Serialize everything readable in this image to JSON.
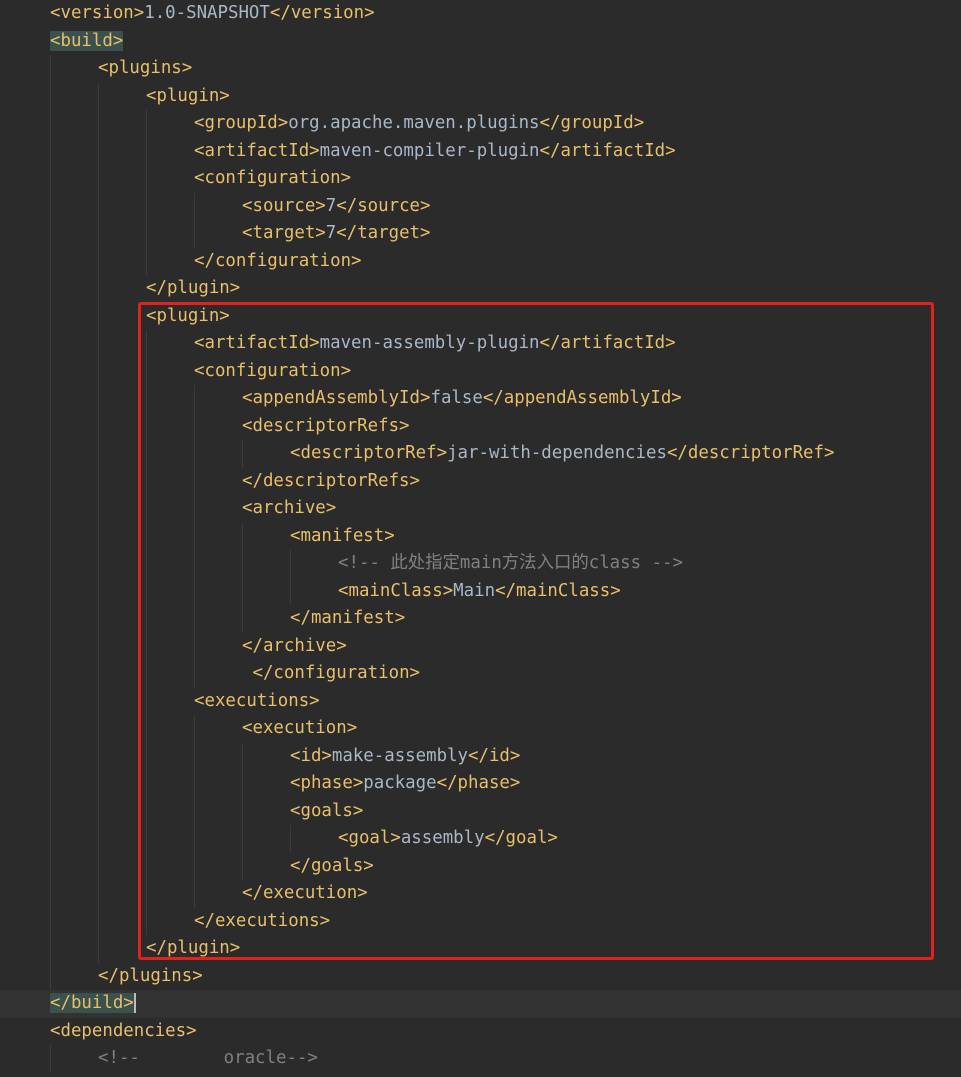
{
  "editor": {
    "language": "xml",
    "colors": {
      "background": "#2b2b2b",
      "tag": "#e8bf6a",
      "text": "#a9b7c6",
      "comment": "#808080",
      "matched_tag_background": "#3b514d",
      "annotation_box": "#e0231c"
    },
    "lines": [
      {
        "indent": 1,
        "parts": [
          {
            "t": "tag",
            "v": "<version>"
          },
          {
            "t": "txt",
            "v": "1.0-SNAPSHOT"
          },
          {
            "t": "tag",
            "v": "</version>"
          }
        ]
      },
      {
        "indent": 1,
        "parts": [
          {
            "t": "hl",
            "v": "<build>"
          }
        ]
      },
      {
        "indent": 2,
        "parts": [
          {
            "t": "tag",
            "v": "<plugins>"
          }
        ]
      },
      {
        "indent": 3,
        "parts": [
          {
            "t": "tag",
            "v": "<plugin>"
          }
        ]
      },
      {
        "indent": 4,
        "parts": [
          {
            "t": "tag",
            "v": "<groupId>"
          },
          {
            "t": "txt",
            "v": "org.apache.maven.plugins"
          },
          {
            "t": "tag",
            "v": "</groupId>"
          }
        ]
      },
      {
        "indent": 4,
        "parts": [
          {
            "t": "tag",
            "v": "<artifactId>"
          },
          {
            "t": "txt",
            "v": "maven-compiler-plugin"
          },
          {
            "t": "tag",
            "v": "</artifactId>"
          }
        ]
      },
      {
        "indent": 4,
        "parts": [
          {
            "t": "tag",
            "v": "<configuration>"
          }
        ]
      },
      {
        "indent": 5,
        "parts": [
          {
            "t": "tag",
            "v": "<source>"
          },
          {
            "t": "txt",
            "v": "7"
          },
          {
            "t": "tag",
            "v": "</source>"
          }
        ]
      },
      {
        "indent": 5,
        "parts": [
          {
            "t": "tag",
            "v": "<target>"
          },
          {
            "t": "txt",
            "v": "7"
          },
          {
            "t": "tag",
            "v": "</target>"
          }
        ]
      },
      {
        "indent": 4,
        "parts": [
          {
            "t": "tag",
            "v": "</configuration>"
          }
        ]
      },
      {
        "indent": 3,
        "parts": [
          {
            "t": "tag",
            "v": "</plugin>"
          }
        ]
      },
      {
        "indent": 3,
        "parts": [
          {
            "t": "tag",
            "v": "<plugin>"
          }
        ]
      },
      {
        "indent": 4,
        "parts": [
          {
            "t": "tag",
            "v": "<artifactId>"
          },
          {
            "t": "txt",
            "v": "maven-assembly-plugin"
          },
          {
            "t": "tag",
            "v": "</artifactId>"
          }
        ]
      },
      {
        "indent": 4,
        "parts": [
          {
            "t": "tag",
            "v": "<configuration>"
          }
        ]
      },
      {
        "indent": 5,
        "parts": [
          {
            "t": "tag",
            "v": "<appendAssemblyId>"
          },
          {
            "t": "txt",
            "v": "false"
          },
          {
            "t": "tag",
            "v": "</appendAssemblyId>"
          }
        ]
      },
      {
        "indent": 5,
        "parts": [
          {
            "t": "tag",
            "v": "<descriptorRefs>"
          }
        ]
      },
      {
        "indent": 6,
        "parts": [
          {
            "t": "tag",
            "v": "<descriptorRef>"
          },
          {
            "t": "txt",
            "v": "jar-with-dependencies"
          },
          {
            "t": "tag",
            "v": "</descriptorRef>"
          }
        ]
      },
      {
        "indent": 5,
        "parts": [
          {
            "t": "tag",
            "v": "</descriptorRefs>"
          }
        ]
      },
      {
        "indent": 5,
        "parts": [
          {
            "t": "tag",
            "v": "<archive>"
          }
        ]
      },
      {
        "indent": 6,
        "parts": [
          {
            "t": "tag",
            "v": "<manifest>"
          }
        ]
      },
      {
        "indent": 7,
        "parts": [
          {
            "t": "cmt",
            "v": "<!-- 此处指定main方法入口的class -->"
          }
        ]
      },
      {
        "indent": 7,
        "parts": [
          {
            "t": "tag",
            "v": "<mainClass>"
          },
          {
            "t": "txt",
            "v": "Main"
          },
          {
            "t": "tag",
            "v": "</mainClass>"
          }
        ]
      },
      {
        "indent": 6,
        "parts": [
          {
            "t": "tag",
            "v": "</manifest>"
          }
        ]
      },
      {
        "indent": 5,
        "parts": [
          {
            "t": "tag",
            "v": "</archive>"
          }
        ]
      },
      {
        "indent": 5,
        "parts": [
          {
            "t": "txt",
            "v": " "
          },
          {
            "t": "tag",
            "v": "</configuration>"
          }
        ]
      },
      {
        "indent": 4,
        "parts": [
          {
            "t": "tag",
            "v": "<executions>"
          }
        ]
      },
      {
        "indent": 5,
        "parts": [
          {
            "t": "tag",
            "v": "<execution>"
          }
        ]
      },
      {
        "indent": 6,
        "parts": [
          {
            "t": "tag",
            "v": "<id>"
          },
          {
            "t": "txt",
            "v": "make-assembly"
          },
          {
            "t": "tag",
            "v": "</id>"
          }
        ]
      },
      {
        "indent": 6,
        "parts": [
          {
            "t": "tag",
            "v": "<phase>"
          },
          {
            "t": "txt",
            "v": "package"
          },
          {
            "t": "tag",
            "v": "</phase>"
          }
        ]
      },
      {
        "indent": 6,
        "parts": [
          {
            "t": "tag",
            "v": "<goals>"
          }
        ]
      },
      {
        "indent": 7,
        "parts": [
          {
            "t": "tag",
            "v": "<goal>"
          },
          {
            "t": "txt",
            "v": "assembly"
          },
          {
            "t": "tag",
            "v": "</goal>"
          }
        ]
      },
      {
        "indent": 6,
        "parts": [
          {
            "t": "tag",
            "v": "</goals>"
          }
        ]
      },
      {
        "indent": 5,
        "parts": [
          {
            "t": "tag",
            "v": "</execution>"
          }
        ]
      },
      {
        "indent": 4,
        "parts": [
          {
            "t": "tag",
            "v": "</executions>"
          }
        ]
      },
      {
        "indent": 3,
        "parts": [
          {
            "t": "tag",
            "v": "</plugin>"
          }
        ]
      },
      {
        "indent": 2,
        "parts": [
          {
            "t": "tag",
            "v": "</plugins>"
          }
        ]
      },
      {
        "indent": 1,
        "current": true,
        "parts": [
          {
            "t": "hl",
            "v": "</build>"
          },
          {
            "t": "caret",
            "v": ""
          }
        ]
      },
      {
        "indent": 1,
        "parts": [
          {
            "t": "tag",
            "v": "<dependencies>"
          }
        ]
      },
      {
        "indent": 2,
        "parts": [
          {
            "t": "cmt",
            "v": "<!--        oracle-->"
          }
        ]
      }
    ]
  }
}
